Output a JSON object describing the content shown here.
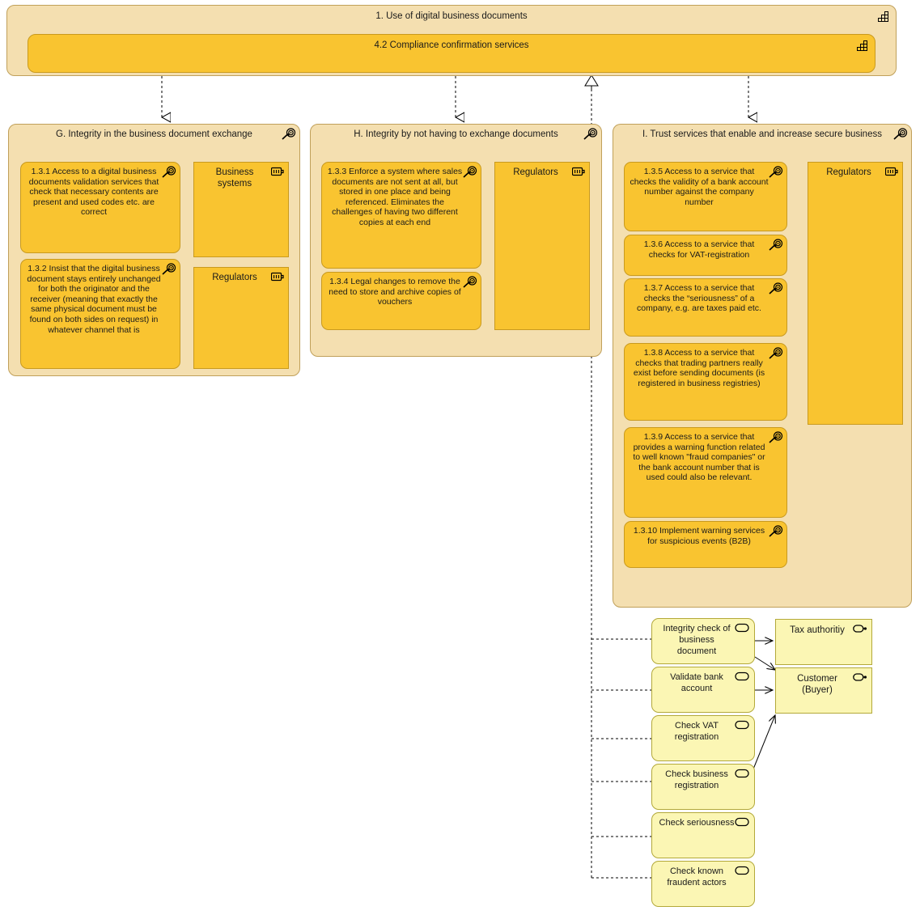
{
  "diagram": {
    "title": "1. Use of digital business documents",
    "type": "archimate-motivation-view"
  },
  "colors": {
    "capability_outer": "#f4dfb0",
    "capability_inner": "#f9c430",
    "goal_fill": "#f9c430",
    "service_fill": "#fbf6b4",
    "border_amber": "#c99a1e",
    "border_sand": "#c0a05a",
    "border_yellow": "#b3a93a",
    "connector": "#000000"
  },
  "header": {
    "outer_label": "1. Use of digital business documents",
    "outer_icon": "capability-icon",
    "inner_label": "4.2 Compliance confirmation services",
    "inner_icon": "capability-icon"
  },
  "groups": [
    {
      "id": "g",
      "label": "G. Integrity in the business document exchange",
      "icon": "goal-icon",
      "goals": [
        {
          "id": "1.3.1",
          "text": "1.3.1 Access to a digital business documents validation services that check that necessary contents are present and used codes etc. are correct",
          "icon": "goal-icon"
        },
        {
          "id": "1.3.2",
          "text": "1.3.2 Insist that the digital business document stays entirely unchanged for both the originator and the receiver (meaning that exactly the same physical document must be found on both sides on request) in whatever channel that is",
          "icon": "goal-icon"
        }
      ],
      "resources": [
        {
          "label": "Business systems",
          "icon": "resource-icon"
        },
        {
          "label": "Regulators",
          "icon": "resource-icon"
        }
      ]
    },
    {
      "id": "h",
      "label": "H. Integrity by not having to exchange documents",
      "icon": "goal-icon",
      "goals": [
        {
          "id": "1.3.3",
          "text": "1.3.3 Enforce a system where sales documents are not sent at all, but stored in one place and being referenced. Eliminates the challenges of having two different copies at each end",
          "icon": "goal-icon"
        },
        {
          "id": "1.3.4",
          "text": "1.3.4 Legal changes to remove the need to store and archive copies of vouchers",
          "icon": "goal-icon"
        }
      ],
      "resources": [
        {
          "label": "Regulators",
          "icon": "resource-icon"
        }
      ]
    },
    {
      "id": "i",
      "label": "I. Trust services that enable and increase secure business",
      "icon": "goal-icon",
      "goals": [
        {
          "id": "1.3.5",
          "text": "1.3.5 Access to a service that checks the validity of a bank account number against the company number",
          "icon": "goal-icon"
        },
        {
          "id": "1.3.6",
          "text": "1.3.6 Access to a service that checks for VAT-registration",
          "icon": "goal-icon"
        },
        {
          "id": "1.3.7",
          "text": "1.3.7 Access to a service that checks the “seriousness” of a company, e.g. are taxes paid etc.",
          "icon": "goal-icon"
        },
        {
          "id": "1.3.8",
          "text": "1.3.8 Access to a service that checks that trading partners really exist before sending documents (is registered in business registries)",
          "icon": "goal-icon"
        },
        {
          "id": "1.3.9",
          "text": "1.3.9 Access to a service that provides a warning function related to well known \"fraud companies\" or the bank account number that is used could also be relevant.",
          "icon": "goal-icon"
        },
        {
          "id": "1.3.10",
          "text": "1.3.10 Implement warning services for suspicious events (B2B)",
          "icon": "goal-icon"
        }
      ],
      "resources": [
        {
          "label": "Regulators",
          "icon": "resource-icon"
        }
      ]
    }
  ],
  "services": [
    {
      "label": "Integrity check of business document",
      "icon": "service-icon"
    },
    {
      "label": "Validate bank account",
      "icon": "service-icon"
    },
    {
      "label": "Check VAT registration",
      "icon": "service-icon"
    },
    {
      "label": "Check business registration",
      "icon": "service-icon"
    },
    {
      "label": "Check seriousness",
      "icon": "service-icon"
    },
    {
      "label": "Check known fraudent actors",
      "icon": "service-icon"
    }
  ],
  "actors": [
    {
      "label": "Tax authoritiy",
      "icon": "actor-icon"
    },
    {
      "label": "Customer (Buyer)",
      "icon": "actor-icon"
    }
  ]
}
